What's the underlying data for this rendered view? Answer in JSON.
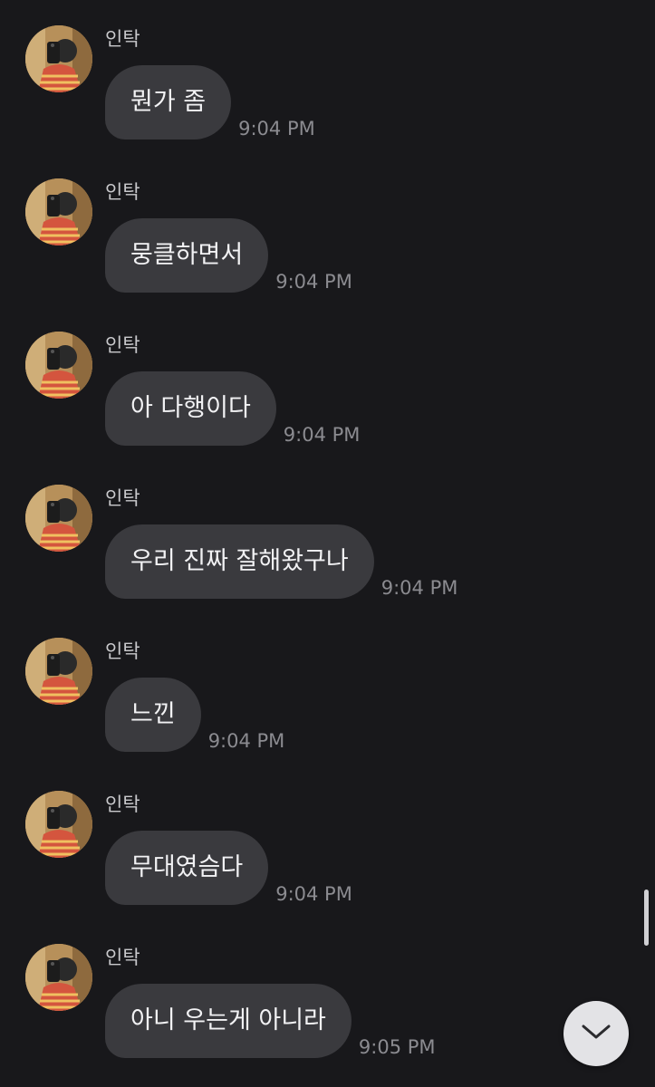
{
  "conversation": {
    "messages": [
      {
        "sender": "인탁",
        "text": "뭔가 좀",
        "time": "9:04 PM"
      },
      {
        "sender": "인탁",
        "text": "뭉클하면서",
        "time": "9:04 PM"
      },
      {
        "sender": "인탁",
        "text": "아 다행이다",
        "time": "9:04 PM"
      },
      {
        "sender": "인탁",
        "text": "우리 진짜 잘해왔구나",
        "time": "9:04 PM"
      },
      {
        "sender": "인탁",
        "text": "느낀",
        "time": "9:04 PM"
      },
      {
        "sender": "인탁",
        "text": "무대였슴다",
        "time": "9:04 PM"
      },
      {
        "sender": "인탁",
        "text": "아니 우는게 아니라",
        "time": "9:05 PM"
      }
    ]
  },
  "controls": {
    "scroll_down_icon": "chevron-down-icon"
  },
  "colors": {
    "background": "#18181b",
    "bubble": "#3a3a3e",
    "text": "#f2f2f4",
    "timestamp": "#8b8b90",
    "scroll_button": "#e3e3e6"
  }
}
